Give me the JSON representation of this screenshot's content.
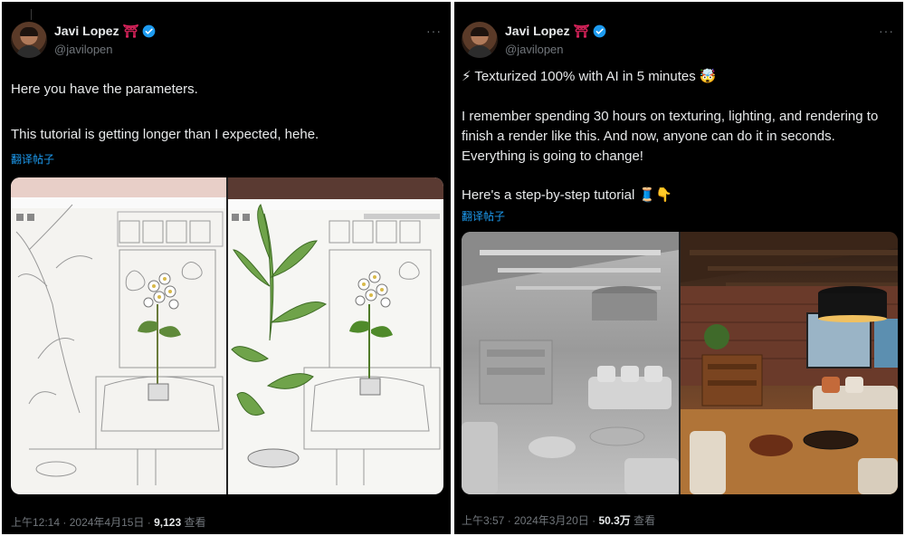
{
  "tweets": [
    {
      "author": {
        "name": "Javi Lopez",
        "badge_emoji": "⛩",
        "handle": "@javilopen"
      },
      "more_label": "···",
      "body_lines": [
        "Here you have the parameters.",
        "This tutorial is getting longer than I expected, hehe."
      ],
      "translate_label": "翻译帖子",
      "media": [
        "sketch-interior-uncolored",
        "sketch-interior-colored-plant"
      ],
      "meta": {
        "time": "上午12:14",
        "sep": "·",
        "date": "2024年4月15日",
        "views_count": "9,123",
        "views_label": "查看"
      }
    },
    {
      "author": {
        "name": "Javi Lopez",
        "badge_emoji": "⛩",
        "handle": "@javilopen"
      },
      "more_label": "···",
      "headline": "⚡ Texturized 100% with AI in 5 minutes 🤯",
      "body_lines": [
        "I remember spending 30 hours on texturing, lighting, and rendering to finish a render like this. And now, anyone can do it in seconds. Everything is going to change!",
        "Here's a step-by-step tutorial 🧵👇"
      ],
      "translate_label": "翻译帖子",
      "media": [
        "grey-untextured-loft-render",
        "textured-loft-render"
      ],
      "meta": {
        "time": "上午3:57",
        "sep": "·",
        "date": "2024年3月20日",
        "views_count": "50.3万",
        "views_label": "查看"
      }
    }
  ],
  "colors": {
    "background": "#000000",
    "text": "#e7e9ea",
    "muted": "#71767b",
    "link": "#1d9bf0",
    "verified": "#1d9bf0"
  }
}
